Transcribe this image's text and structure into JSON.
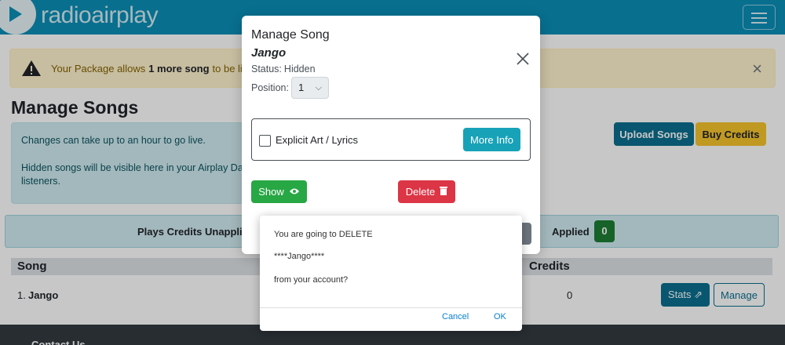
{
  "navbar": {
    "logo_text": "radioairplay",
    "brand_color": "#0b8fb8",
    "menu_icon": "hamburger-menu-icon"
  },
  "alert": {
    "prefix": "Your Package allows",
    "highlight": "1 more song",
    "suffix": "to be live",
    "icon": "warning-icon",
    "close": "×"
  },
  "page": {
    "title": "Manage Songs"
  },
  "info": {
    "line1": "Changes can take up to an hour to go live.",
    "line2": "Hidden songs will be visible here in your Airplay Das",
    "line3": "listeners."
  },
  "actions": {
    "upload": "Upload Songs",
    "buy": "Buy Credits"
  },
  "credits_bar": {
    "unapplied": "Plays Credits Unapplied",
    "applied": "Applied",
    "applied_count": "0"
  },
  "table": {
    "headers": {
      "song": "Song",
      "credits": "Credits"
    },
    "rows": [
      {
        "num": "1.",
        "name": "Jango",
        "credits": "0",
        "stats": "Stats",
        "manage": "Manage"
      }
    ]
  },
  "footer": {
    "text": "Contact Us"
  },
  "modal": {
    "title": "Manage Song",
    "song": "Jango",
    "status_label": "Status:",
    "status_value": "Hidden",
    "position_label": "Position:",
    "position_value": "1",
    "explicit_label": "Explicit Art / Lyrics",
    "more_info": "More Info",
    "show": "Show",
    "delete": "Delete"
  },
  "confirm": {
    "line1": "You are going to DELETE",
    "line2": "****Jango****",
    "line3": "from your account?",
    "cancel": "Cancel",
    "ok": "OK"
  }
}
